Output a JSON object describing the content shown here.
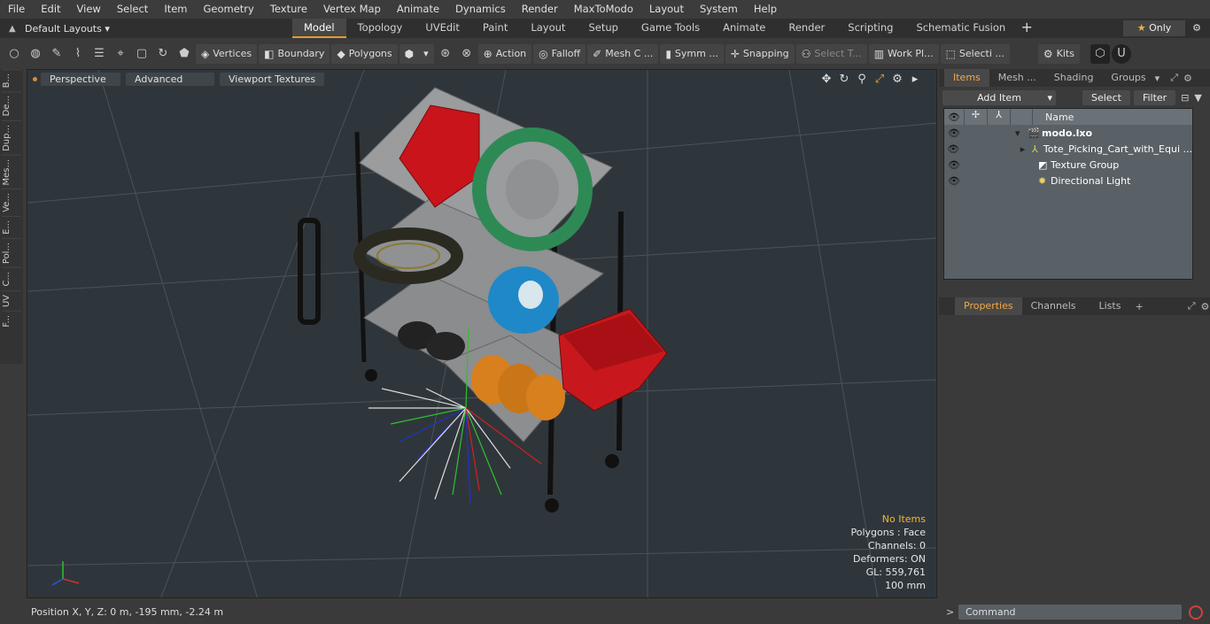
{
  "menu": [
    "File",
    "Edit",
    "View",
    "Select",
    "Item",
    "Geometry",
    "Texture",
    "Vertex Map",
    "Animate",
    "Dynamics",
    "Render",
    "MaxToModo",
    "Layout",
    "System",
    "Help"
  ],
  "layouts_label": "Default Layouts",
  "tabs": [
    "Model",
    "Topology",
    "UVEdit",
    "Paint",
    "Layout",
    "Setup",
    "Game Tools",
    "Animate",
    "Render",
    "Scripting",
    "Schematic Fusion"
  ],
  "only_label": "Only",
  "toolbar": {
    "vertices": "Vertices",
    "boundary": "Boundary",
    "polygons": "Polygons",
    "action": "Action",
    "falloff": "Falloff",
    "mesh": "Mesh C ...",
    "symm": "Symm ...",
    "snapping": "Snapping",
    "select_t": "Select T...",
    "workpl": "Work Pl...",
    "selecti": "Selecti ...",
    "kits": "Kits"
  },
  "left_tabs": [
    "B...",
    "De...",
    "Dup...",
    "Mes...",
    "Ve...",
    "E...",
    "Pol...",
    "C...",
    "UV",
    "F..."
  ],
  "viewport": {
    "perspective": "Perspective",
    "advanced": "Advanced",
    "textures": "Viewport Textures",
    "stats": {
      "no_items": "No Items",
      "polygons": "Polygons : Face",
      "channels": "Channels: 0",
      "deformers": "Deformers: ON",
      "gl": "GL: 559,761",
      "scale": "100 mm"
    }
  },
  "status": {
    "position": "Position X, Y, Z:   0 m, -195 mm, -2.24 m"
  },
  "right_panel": {
    "tabs": [
      "Items",
      "Mesh ...",
      "Shading",
      "Groups"
    ],
    "add_item": "Add Item",
    "select": "Select",
    "filter": "Filter",
    "name_header": "Name",
    "items": [
      {
        "label": "modo.lxo",
        "indent": 0
      },
      {
        "label": "Tote_Picking_Cart_with_Equi ...",
        "indent": 1
      },
      {
        "label": "Texture Group",
        "indent": 1
      },
      {
        "label": "Directional Light",
        "indent": 1
      }
    ],
    "tabs2": [
      "Properties",
      "Channels",
      "Lists"
    ]
  },
  "command_placeholder": "Command"
}
